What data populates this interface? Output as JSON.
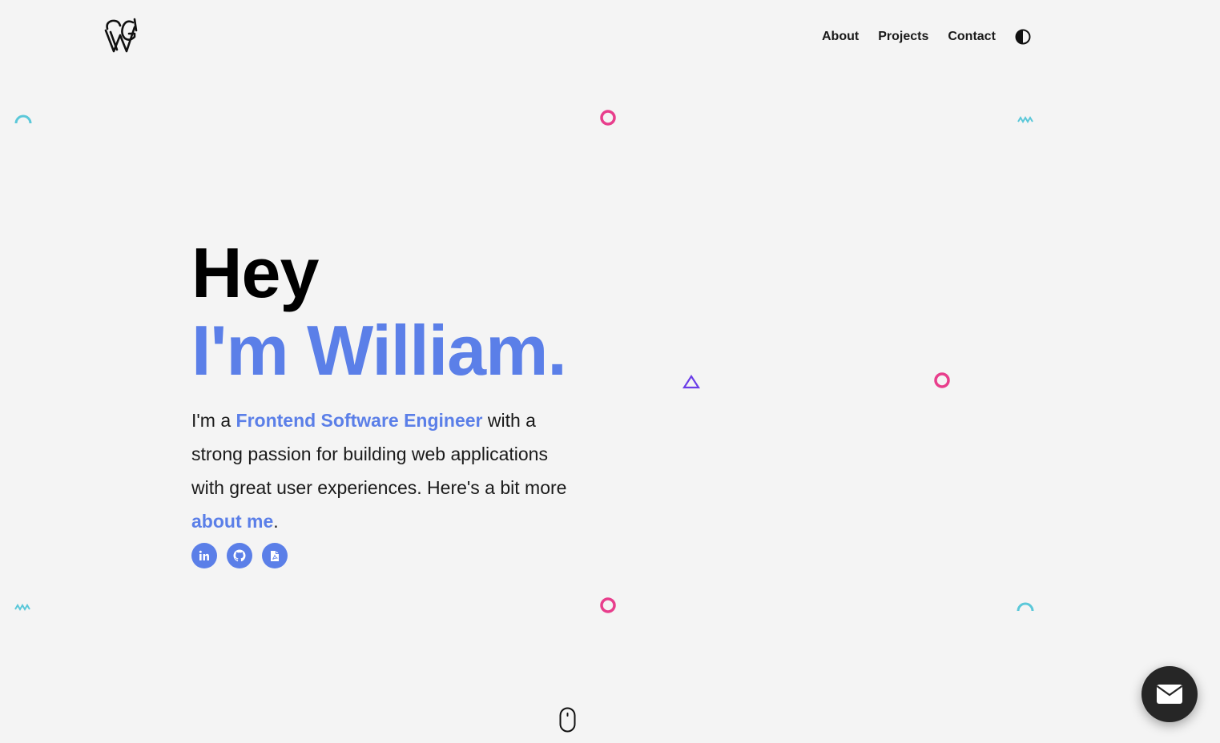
{
  "header": {
    "logo_icon": "wg-monogram-logo",
    "nav": [
      {
        "label": "About"
      },
      {
        "label": "Projects"
      },
      {
        "label": "Contact"
      }
    ],
    "theme_toggle_icon": "half-circle-contrast-icon"
  },
  "hero": {
    "greeting": "Hey",
    "name_line": "I'm William.",
    "intro": {
      "part1": "I'm a ",
      "role": "Frontend Software Engineer",
      "part2": " with a strong passion for building web applications with great user experiences.",
      "part3": "Here's a bit more ",
      "link": "about me",
      "part4": "."
    },
    "socials": [
      {
        "icon": "linkedin-icon"
      },
      {
        "icon": "github-icon"
      },
      {
        "icon": "pdf-resume-icon"
      }
    ]
  },
  "scroll_indicator_icon": "mouse-scroll-icon",
  "contact_fab_icon": "envelope-icon",
  "colors": {
    "accent": "#5b7fe8",
    "background": "#f4f4f4",
    "deco_pink": "#e83e8c",
    "deco_teal": "#5bc8d9",
    "deco_purple": "#6b3ee8",
    "fab": "#262626"
  }
}
